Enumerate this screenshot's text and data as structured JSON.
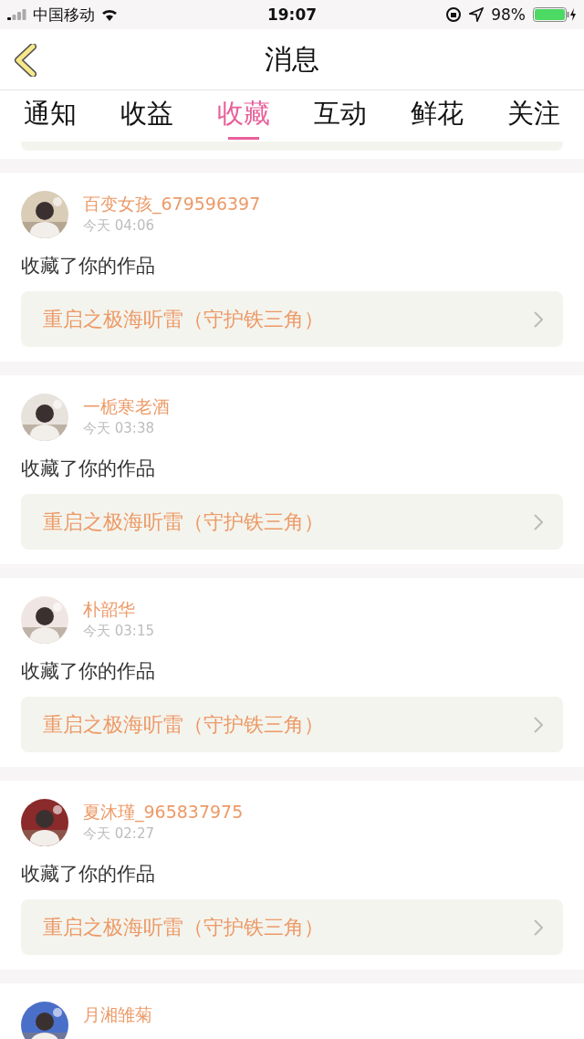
{
  "status_bar": {
    "carrier": "中国移动",
    "time": "19:07",
    "battery": "98%"
  },
  "header": {
    "title": "消息"
  },
  "tabs": [
    {
      "label": "通知",
      "selected": false
    },
    {
      "label": "收益",
      "selected": false
    },
    {
      "label": "收藏",
      "selected": true
    },
    {
      "label": "互动",
      "selected": false
    },
    {
      "label": "鲜花",
      "selected": false
    },
    {
      "label": "关注",
      "selected": false
    }
  ],
  "messages": [
    {
      "user": "百变女孩_679596397",
      "time": "今天 04:06",
      "action": "收藏了你的作品",
      "work": "重启之极海听雷（守护铁三角）"
    },
    {
      "user": "一栀寒老酒",
      "time": "今天 03:38",
      "action": "收藏了你的作品",
      "work": "重启之极海听雷（守护铁三角）"
    },
    {
      "user": "朴韶华",
      "time": "今天 03:15",
      "action": "收藏了你的作品",
      "work": "重启之极海听雷（守护铁三角）"
    },
    {
      "user": "夏沐瑾_965837975",
      "time": "今天 02:27",
      "action": "收藏了你的作品",
      "work": "重启之极海听雷（守护铁三角）"
    },
    {
      "user": "月湘雏菊"
    }
  ]
}
